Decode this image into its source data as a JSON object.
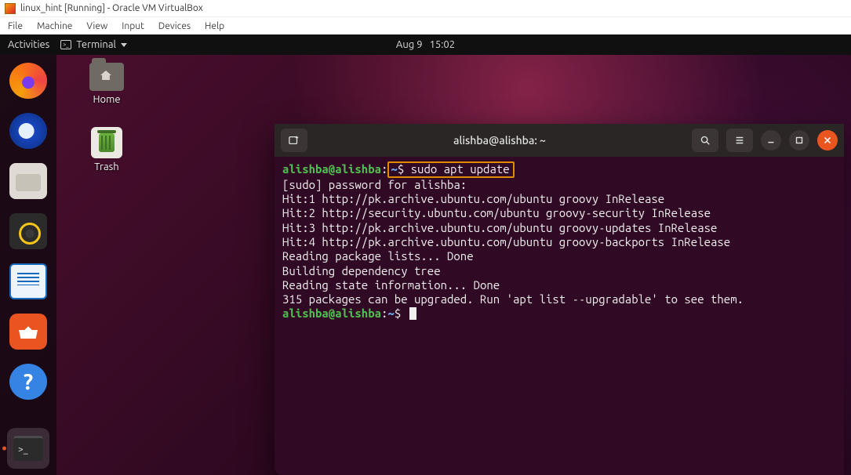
{
  "vbox": {
    "title": "linux_hint [Running] - Oracle VM VirtualBox",
    "menu": [
      "File",
      "Machine",
      "View",
      "Input",
      "Devices",
      "Help"
    ]
  },
  "topbar": {
    "activities": "Activities",
    "app_name": "Terminal",
    "date": "Aug 9",
    "time": "15:02"
  },
  "desktop_icons": {
    "home": "Home",
    "trash": "Trash"
  },
  "dock": {
    "items": [
      {
        "name": "firefox-icon"
      },
      {
        "name": "thunderbird-icon"
      },
      {
        "name": "files-icon"
      },
      {
        "name": "rhythmbox-icon"
      },
      {
        "name": "libreoffice-writer-icon"
      },
      {
        "name": "ubuntu-software-icon"
      },
      {
        "name": "help-icon"
      }
    ],
    "active": "terminal-icon"
  },
  "terminal": {
    "title": "alishba@alishba: ~",
    "prompt_user": "alishba@alishba",
    "prompt_sep": ":",
    "prompt_path": "~",
    "prompt_sym": "$",
    "command": "sudo apt update",
    "output": [
      "[sudo] password for alishba:",
      "Hit:1 http://pk.archive.ubuntu.com/ubuntu groovy InRelease",
      "Hit:2 http://security.ubuntu.com/ubuntu groovy-security InRelease",
      "Hit:3 http://pk.archive.ubuntu.com/ubuntu groovy-updates InRelease",
      "Hit:4 http://pk.archive.ubuntu.com/ubuntu groovy-backports InRelease",
      "Reading package lists... Done",
      "Building dependency tree",
      "Reading state information... Done",
      "315 packages can be upgraded. Run 'apt list --upgradable' to see them."
    ]
  }
}
